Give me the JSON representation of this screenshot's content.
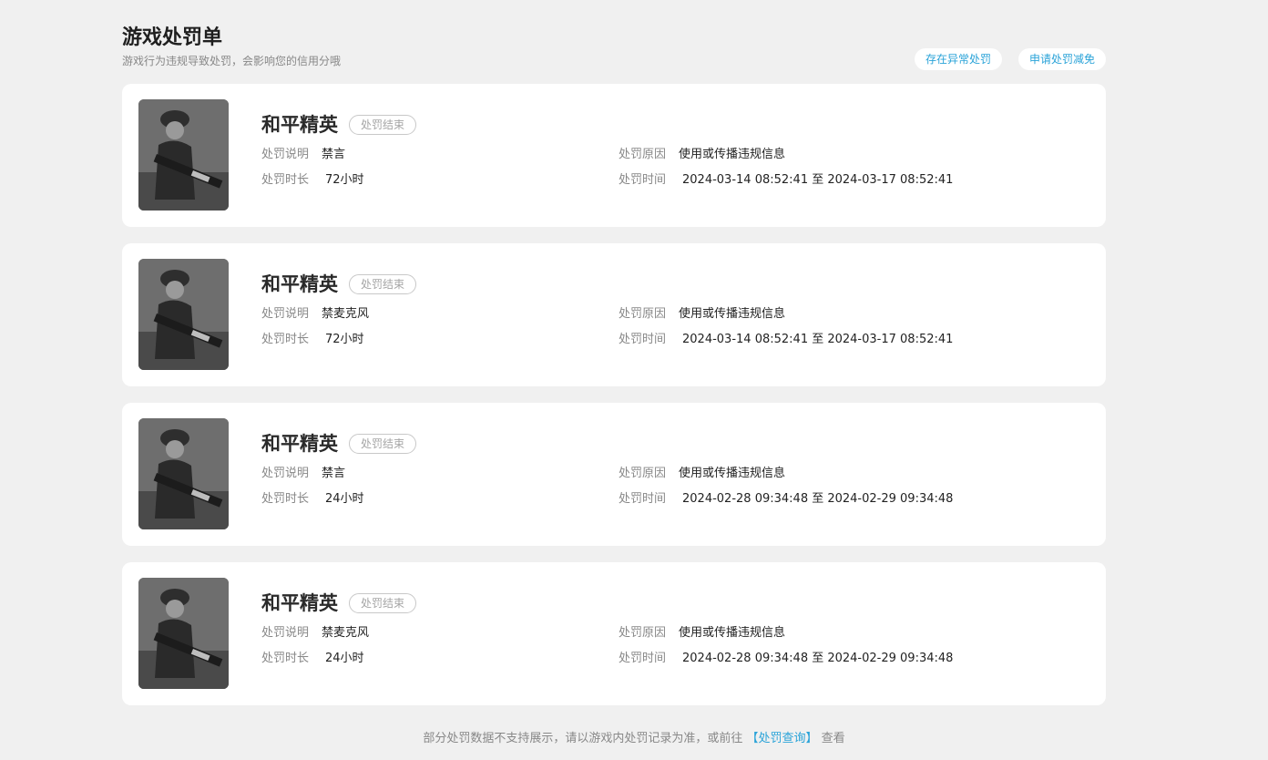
{
  "header": {
    "title": "游戏处罚单",
    "subtitle": "游戏行为违规导致处罚，会影响您的信用分哦",
    "actions": {
      "abnormal": "存在异常处罚",
      "reduce": "申请处罚减免"
    }
  },
  "labels": {
    "desc": "处罚说明",
    "duration": "处罚时长",
    "reason": "处罚原因",
    "time": "处罚时间"
  },
  "records": [
    {
      "game": "和平精英",
      "status": "处罚结束",
      "desc": "禁言",
      "duration": "72小时",
      "reason": "使用或传播违规信息",
      "time": "2024-03-14 08:52:41 至 2024-03-17 08:52:41"
    },
    {
      "game": "和平精英",
      "status": "处罚结束",
      "desc": "禁麦克风",
      "duration": "72小时",
      "reason": "使用或传播违规信息",
      "time": "2024-03-14 08:52:41 至 2024-03-17 08:52:41"
    },
    {
      "game": "和平精英",
      "status": "处罚结束",
      "desc": "禁言",
      "duration": "24小时",
      "reason": "使用或传播违规信息",
      "time": "2024-02-28 09:34:48 至 2024-02-29 09:34:48"
    },
    {
      "game": "和平精英",
      "status": "处罚结束",
      "desc": "禁麦克风",
      "duration": "24小时",
      "reason": "使用或传播违规信息",
      "time": "2024-02-28 09:34:48 至 2024-02-29 09:34:48"
    }
  ],
  "footer": {
    "text": "部分处罚数据不支持展示，请以游戏内处罚记录为准，或前往",
    "link": "【处罚查询】",
    "suffix": "查看"
  },
  "colors": {
    "accent": "#2aa3d8",
    "background": "#f0f0f0"
  }
}
